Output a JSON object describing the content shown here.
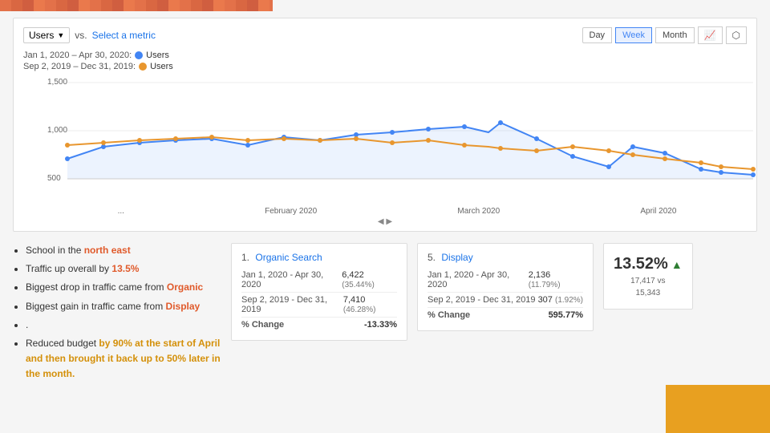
{
  "topPattern": true,
  "chart": {
    "metric": "Users",
    "vsLabel": "vs.",
    "selectMetricLabel": "Select a metric",
    "periodButtons": [
      "Day",
      "Week",
      "Month"
    ],
    "activePeriod": "Week",
    "legend": [
      {
        "id": "legend-period1",
        "date": "Jan 1, 2020 – Apr 30, 2020:",
        "metric": "Users",
        "color": "#4285f4"
      },
      {
        "id": "legend-period2",
        "date": "Sep 2, 2019 – Dec 31, 2019:",
        "metric": "Users",
        "color": "#e8962e"
      }
    ],
    "yLabels": [
      "1,500",
      "1,000",
      "500"
    ],
    "xLabels": [
      "...",
      "February 2020",
      "March 2020",
      "April 2020"
    ],
    "scrollLabel": "◀▶"
  },
  "bullets": [
    {
      "text": "School in the ",
      "highlight": "north east",
      "highlightColor": "red-bold",
      "suffix": ""
    },
    {
      "text": "Traffic up overall by ",
      "highlight": "13.5%",
      "highlightColor": "red-bold",
      "suffix": ""
    },
    {
      "text": "Biggest drop in traffic came from ",
      "highlight": "Organic",
      "highlightColor": "orange-bold",
      "suffix": ""
    },
    {
      "text": "Biggest gain in traffic came from ",
      "highlight": "Display",
      "highlightColor": "red-bold",
      "suffix": ""
    },
    {
      "text": "."
    },
    {
      "text": "Reduced budget ",
      "highlight": "by 90% at the start of April and then brought it back up to 50% later in the month.",
      "highlightColor": "highlight-bold",
      "suffix": ""
    }
  ],
  "card1": {
    "num": "1.",
    "title": "Organic Search",
    "rows": [
      {
        "label": "Jan 1, 2020 - Apr 30, 2020",
        "value": "6,422",
        "sub": "(35.44%)"
      },
      {
        "label": "Sep 2, 2019 - Dec 31, 2019",
        "value": "7,410",
        "sub": "(46.28%)"
      },
      {
        "label": "% Change",
        "value": "-13.33%"
      }
    ]
  },
  "card2": {
    "num": "5.",
    "title": "Display",
    "rows": [
      {
        "label": "Jan 1, 2020 - Apr 30, 2020",
        "value": "2,136",
        "sub": "(11.79%)"
      },
      {
        "label": "Sep 2, 2019 - Dec 31, 2019",
        "value": "307",
        "sub": "(1.92%)"
      },
      {
        "label": "% Change",
        "value": "595.77%"
      }
    ]
  },
  "summary": {
    "percentage": "13.52%",
    "arrowIcon": "▲",
    "sub1": "17,417 vs",
    "sub2": "15,343"
  },
  "labels": {
    "day": "Day",
    "week": "Week",
    "month": "Month"
  }
}
